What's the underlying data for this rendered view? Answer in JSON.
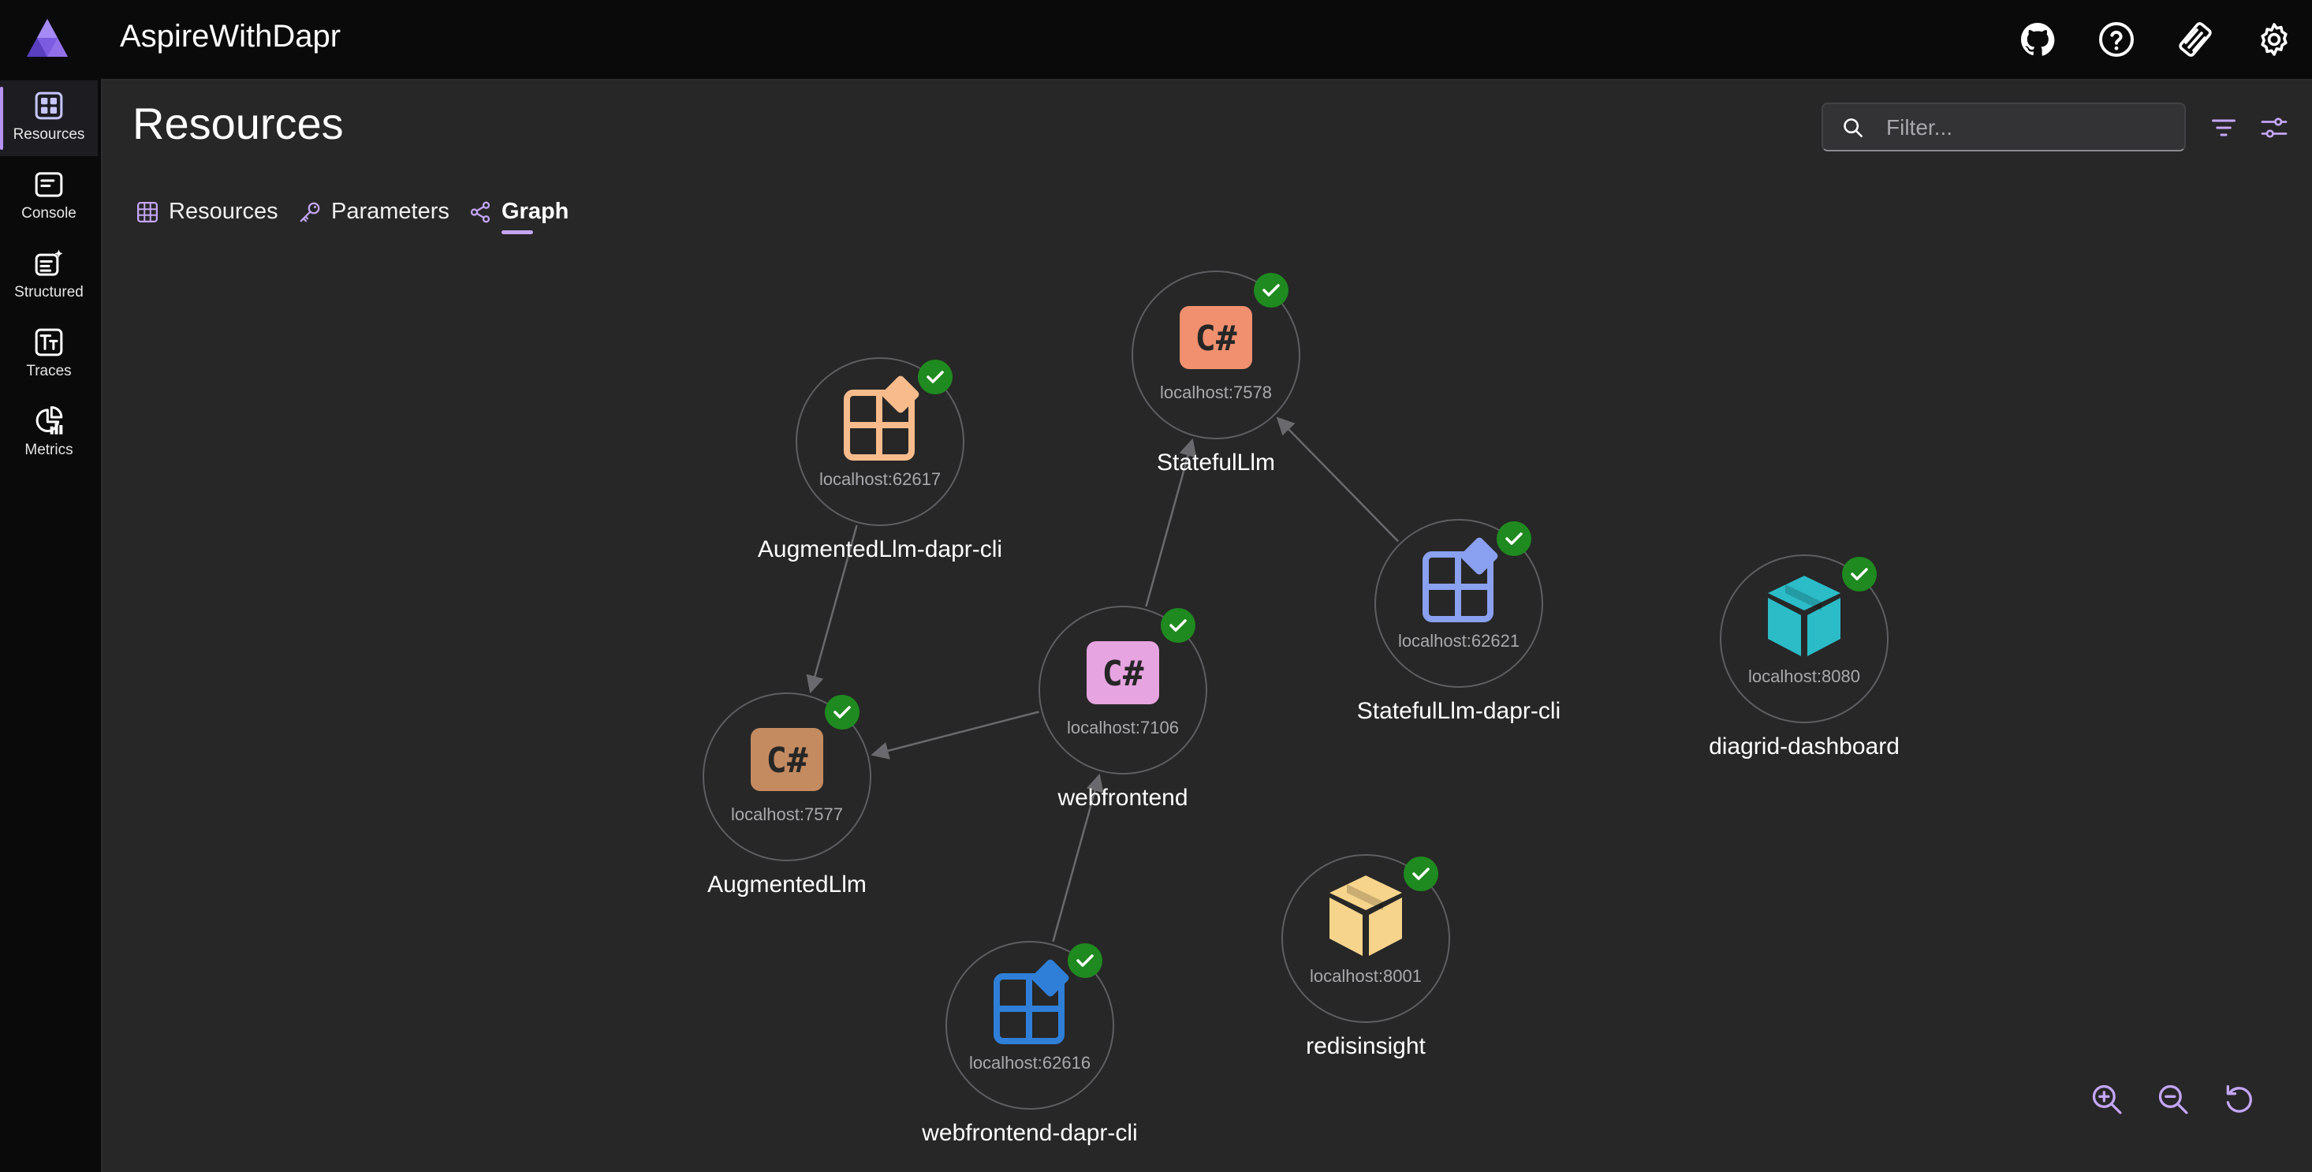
{
  "app": {
    "title": "AspireWithDapr"
  },
  "header_icons": [
    "github-icon",
    "help-icon",
    "developer-icon",
    "settings-icon"
  ],
  "nav": [
    {
      "id": "resources",
      "label": "Resources",
      "icon": "grid-icon",
      "active": true
    },
    {
      "id": "console",
      "label": "Console",
      "icon": "console-icon",
      "active": false
    },
    {
      "id": "structured",
      "label": "Structured",
      "icon": "structured-logs-icon",
      "active": false
    },
    {
      "id": "traces",
      "label": "Traces",
      "icon": "traces-icon",
      "active": false
    },
    {
      "id": "metrics",
      "label": "Metrics",
      "icon": "metrics-icon",
      "active": false
    }
  ],
  "page": {
    "title": "Resources",
    "filter_placeholder": "Filter..."
  },
  "tabs": [
    {
      "label": "Resources",
      "icon": "table-icon",
      "active": false
    },
    {
      "label": "Parameters",
      "icon": "key-icon",
      "active": false
    },
    {
      "label": "Graph",
      "icon": "share-graph-icon",
      "active": true
    }
  ],
  "graph": {
    "nodes": [
      {
        "id": "statefulllm",
        "name": "StatefulLlm",
        "url": "localhost:7578",
        "kind": "project",
        "color": "#f0906e",
        "status": "running"
      },
      {
        "id": "augmentedllm-dapr-cli",
        "name": "AugmentedLlm-dapr-cli",
        "url": "localhost:62617",
        "kind": "executable",
        "color": "#f8bc8c",
        "status": "running"
      },
      {
        "id": "statefulllm-dapr-cli",
        "name": "StatefulLlm-dapr-cli",
        "url": "localhost:62621",
        "kind": "executable",
        "color": "#8aa0f0",
        "status": "running"
      },
      {
        "id": "diagrid-dashboard",
        "name": "diagrid-dashboard",
        "url": "localhost:8080",
        "kind": "container",
        "color": "#2bbcc8",
        "status": "running"
      },
      {
        "id": "webfrontend",
        "name": "webfrontend",
        "url": "localhost:7106",
        "kind": "project",
        "color": "#e6a4e0",
        "status": "running"
      },
      {
        "id": "augmentedllm",
        "name": "AugmentedLlm",
        "url": "localhost:7577",
        "kind": "project",
        "color": "#c48b60",
        "status": "running"
      },
      {
        "id": "redisinsight",
        "name": "redisinsight",
        "url": "localhost:8001",
        "kind": "container",
        "color": "#f6d48c",
        "status": "running"
      },
      {
        "id": "webfrontend-dapr-cli",
        "name": "webfrontend-dapr-cli",
        "url": "localhost:62616",
        "kind": "executable",
        "color": "#2f7fd8",
        "status": "running"
      }
    ],
    "edges": [
      {
        "from": "augmentedllm-dapr-cli",
        "to": "augmentedllm"
      },
      {
        "from": "statefulllm-dapr-cli",
        "to": "statefulllm"
      },
      {
        "from": "webfrontend",
        "to": "statefulllm"
      },
      {
        "from": "webfrontend",
        "to": "augmentedllm"
      },
      {
        "from": "webfrontend-dapr-cli",
        "to": "webfrontend"
      }
    ],
    "colors": {
      "running": "#1f8a1f",
      "edge": "#6a6a6e",
      "ring": "#5e5e62"
    }
  },
  "zoom_controls": [
    "zoom-in-icon",
    "zoom-out-icon",
    "reset-icon"
  ]
}
